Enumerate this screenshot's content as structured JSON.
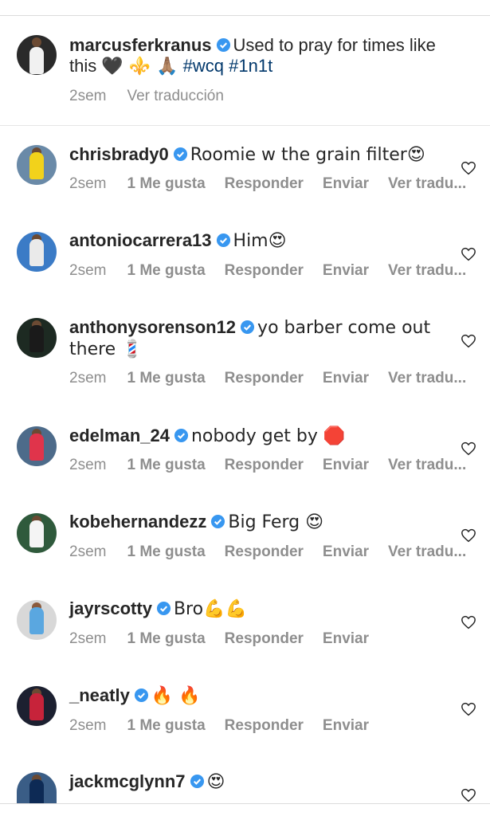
{
  "caption": {
    "username": "marcusferkranus",
    "text_part1": "Used to pray for times like this",
    "emojis": "🖤 ⚜️ 🙏🏽",
    "hashtag1": "#wcq",
    "hashtag2": "#1n1t",
    "time": "2sem",
    "translate": "Ver traducción"
  },
  "comments": [
    {
      "username": "chrisbrady0",
      "text": "Roomie w the grain filter😍",
      "time": "2sem",
      "likes": "1 Me gusta",
      "reply": "Responder",
      "send": "Enviar",
      "translate": "Ver tradu..."
    },
    {
      "username": "antoniocarrera13",
      "text": "Him😍",
      "time": "2sem",
      "likes": "1 Me gusta",
      "reply": "Responder",
      "send": "Enviar",
      "translate": "Ver tradu..."
    },
    {
      "username": "anthonysorenson12",
      "text": "yo barber come out there 💈",
      "time": "2sem",
      "likes": "1 Me gusta",
      "reply": "Responder",
      "send": "Enviar",
      "translate": "Ver tradu..."
    },
    {
      "username": "edelman_24",
      "text": "nobody get by 🛑",
      "time": "2sem",
      "likes": "1 Me gusta",
      "reply": "Responder",
      "send": "Enviar",
      "translate": "Ver tradu..."
    },
    {
      "username": "kobehernandezz",
      "text": "Big Ferg 😍",
      "time": "2sem",
      "likes": "1 Me gusta",
      "reply": "Responder",
      "send": "Enviar",
      "translate": "Ver tradu..."
    },
    {
      "username": "jayrscotty",
      "text": "Bro💪💪",
      "time": "2sem",
      "likes": "1 Me gusta",
      "reply": "Responder",
      "send": "Enviar",
      "translate": ""
    },
    {
      "username": "_neatly",
      "text": "🔥 🔥",
      "time": "2sem",
      "likes": "1 Me gusta",
      "reply": "Responder",
      "send": "Enviar",
      "translate": ""
    },
    {
      "username": "jackmcglynn7",
      "text": "😍",
      "time": "",
      "likes": "",
      "reply": "",
      "send": "",
      "translate": ""
    }
  ],
  "colors": {
    "verified": "#3897f0",
    "meta": "#8e8e8e",
    "hashtag": "#00376b"
  }
}
